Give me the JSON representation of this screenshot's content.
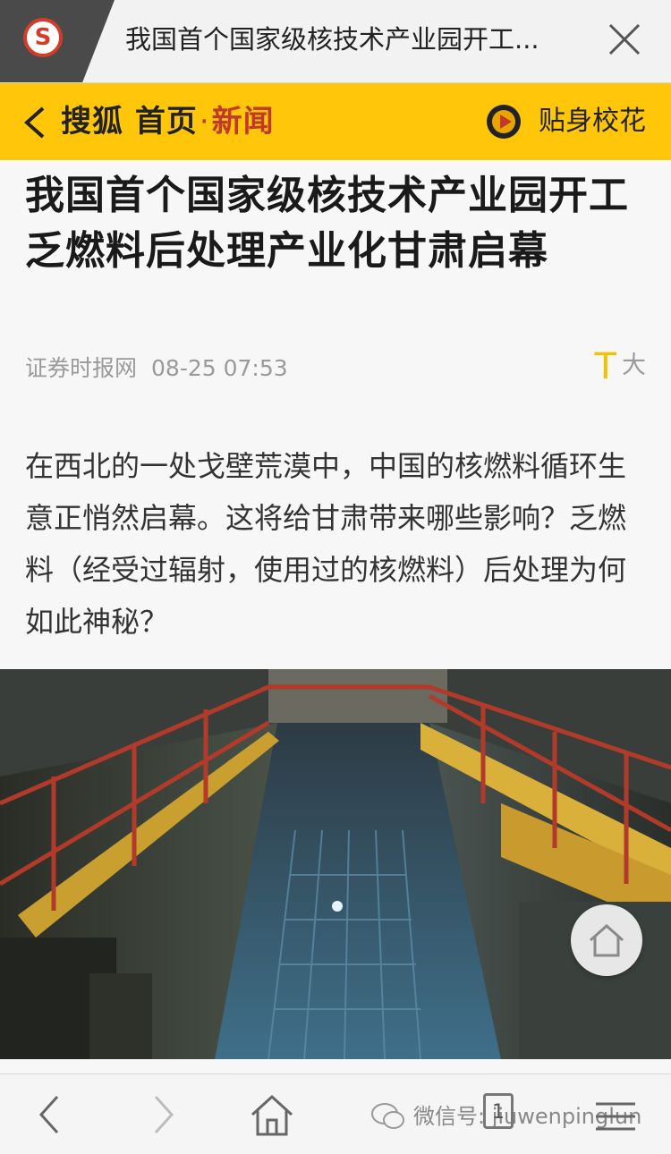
{
  "tab": {
    "logo_letter": "S",
    "title": "我国首个国家级核技术产业园开工...",
    "close_icon": "close-icon"
  },
  "header": {
    "brand": "搜狐 首页",
    "separator": "·",
    "section": "新闻",
    "promo": "贴身校花",
    "accent": "#ffc60a"
  },
  "article": {
    "headline": "我国首个国家级核技术产业园开工 乏燃料后处理产业化甘肃启幕",
    "source": "证券时报网",
    "time": "08-25 07:53",
    "font_toggle_small": "T",
    "font_toggle_big": "大",
    "lead": "在西北的一处戈壁荒漠中，中国的核燃料循环生意正悄然启幕。这将给甘肃带来哪些影响？乏燃料（经受过辐射，使用过的核燃料）后处理为何如此神秘？"
  },
  "toolbar": {
    "tab_count": "1",
    "watermark": "微信号: jiuwenpinglun"
  }
}
